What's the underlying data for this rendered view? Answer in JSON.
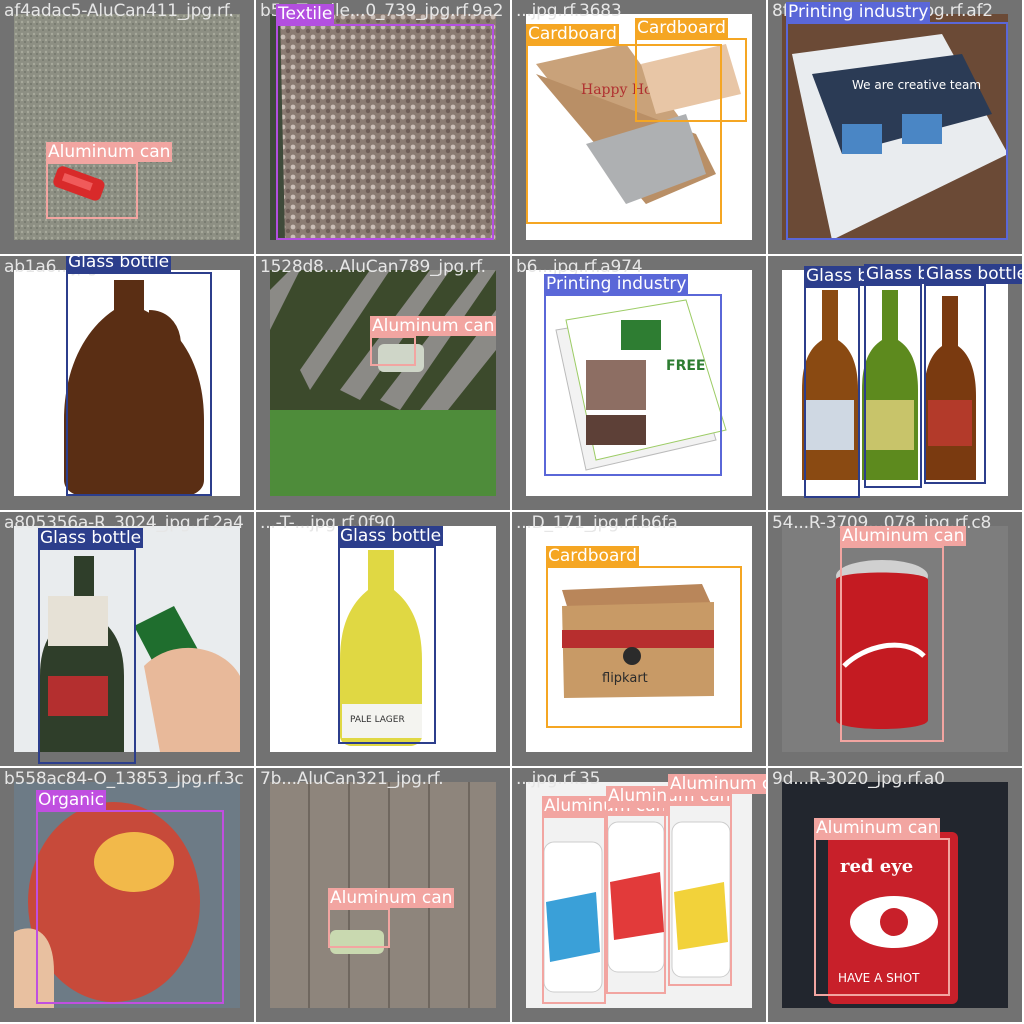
{
  "colors": {
    "Aluminum can": "#f2a5a1",
    "Textile": "#b34fe0",
    "Cardboard": "#f5a623",
    "Printing industry": "#5a67d8",
    "Glass bottle": "#2c3e8c",
    "Organic": "#c04fe0"
  },
  "tiles": [
    {
      "filename": "af4adac5-AluCan411_jpg.rf.",
      "boxes": [
        {
          "label": "Aluminum can"
        }
      ]
    },
    {
      "filename": "b5...Textile...0_739_jpg.rf.9a2",
      "boxes": [
        {
          "label": "Textile"
        }
      ]
    },
    {
      "filename": "...jpg.rf.3683",
      "boxes": [
        {
          "label": "Cardboard"
        },
        {
          "label": "Cardboard"
        }
      ]
    },
    {
      "filename": "8f...7067-R-8059_jpg.rf.af2",
      "boxes": [
        {
          "label": "Printing industry"
        }
      ]
    },
    {
      "filename": "ab1a6...jpg.rf.bb7",
      "boxes": [
        {
          "label": "Glass bottle"
        }
      ]
    },
    {
      "filename": "1528d8...AluCan789_jpg.rf.",
      "boxes": [
        {
          "label": "Aluminum can"
        }
      ]
    },
    {
      "filename": "b6...jpg.rf.a974",
      "boxes": [
        {
          "label": "Printing industry"
        }
      ]
    },
    {
      "filename": "",
      "boxes": [
        {
          "label": "Glass b"
        },
        {
          "label": "Glass b"
        },
        {
          "label": "Glass bottle"
        }
      ]
    },
    {
      "filename": "a805356a-R_3024_jpg.rf.2a4",
      "boxes": [
        {
          "label": "Glass bottle"
        }
      ]
    },
    {
      "filename": "...-T-...jpg.rf.0f90",
      "boxes": [
        {
          "label": "Glass bottle"
        }
      ]
    },
    {
      "filename": "...D_171_jpg.rf.b6fa",
      "boxes": [
        {
          "label": "Cardboard"
        }
      ]
    },
    {
      "filename": "54...R-3709...078_jpg.rf.c8",
      "boxes": [
        {
          "label": "Aluminum can"
        }
      ]
    },
    {
      "filename": "b558ac84-O_13853_jpg.rf.3c",
      "boxes": [
        {
          "label": "Organic"
        }
      ]
    },
    {
      "filename": "7b...AluCan321_jpg.rf.",
      "boxes": [
        {
          "label": "Aluminum can"
        }
      ]
    },
    {
      "filename": "...jpg.rf.35",
      "boxes": [
        {
          "label": "Aluminum can"
        },
        {
          "label": "Aluminum can"
        },
        {
          "label": "Aluminum can"
        }
      ]
    },
    {
      "filename": "9d...R-3020_jpg.rf.a0",
      "boxes": [
        {
          "label": "Aluminum can"
        }
      ]
    }
  ]
}
